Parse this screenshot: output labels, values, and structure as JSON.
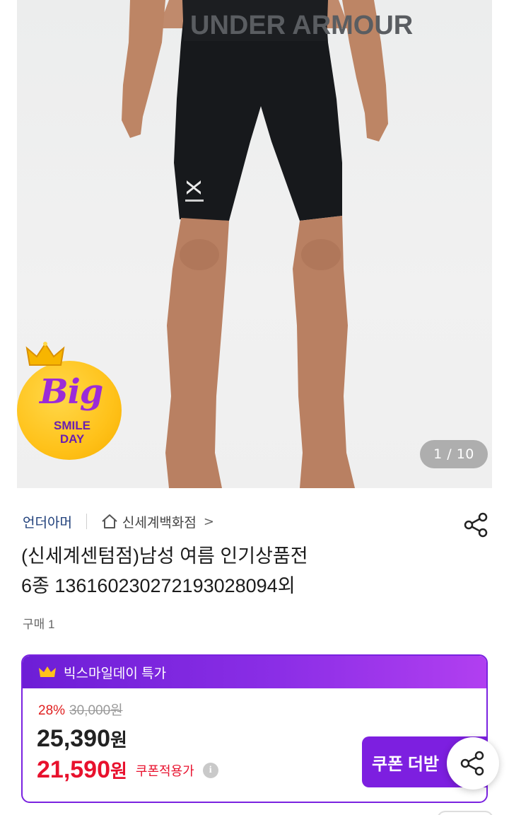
{
  "hero": {
    "waistband_text": "UNDER ARMOUR",
    "image_counter": "1 / 10",
    "badge": {
      "big": "Big",
      "line1": "SMILE",
      "line2": "DAY"
    }
  },
  "brand": {
    "name": "언더아머",
    "store": "신세계백화점",
    "store_chevron": ">"
  },
  "product": {
    "title_line1": "(신세계센텀점)남성 여름 인기상품전",
    "title_line2": "6종 1361602302721930280​94외",
    "bought": "구매 1"
  },
  "promo": {
    "label": "빅스마일데이 특가"
  },
  "pricing": {
    "discount_rate": "28%",
    "original_price": "30,000원",
    "price_number": "25,390",
    "price_unit": "원",
    "coupon_price_number": "21,590",
    "coupon_price_unit": "원",
    "coupon_label": "쿠폰적용가",
    "info_icon": "i",
    "coupon_button": "쿠폰 더받"
  },
  "icons": {
    "share_top": "share-icon",
    "share_float": "share-icon",
    "home": "home-icon",
    "crown": "crown-icon"
  },
  "colors": {
    "accent_purple": "#7d1fe0",
    "sale_red": "#e8112d",
    "brand_navy": "#1f3f7a"
  }
}
